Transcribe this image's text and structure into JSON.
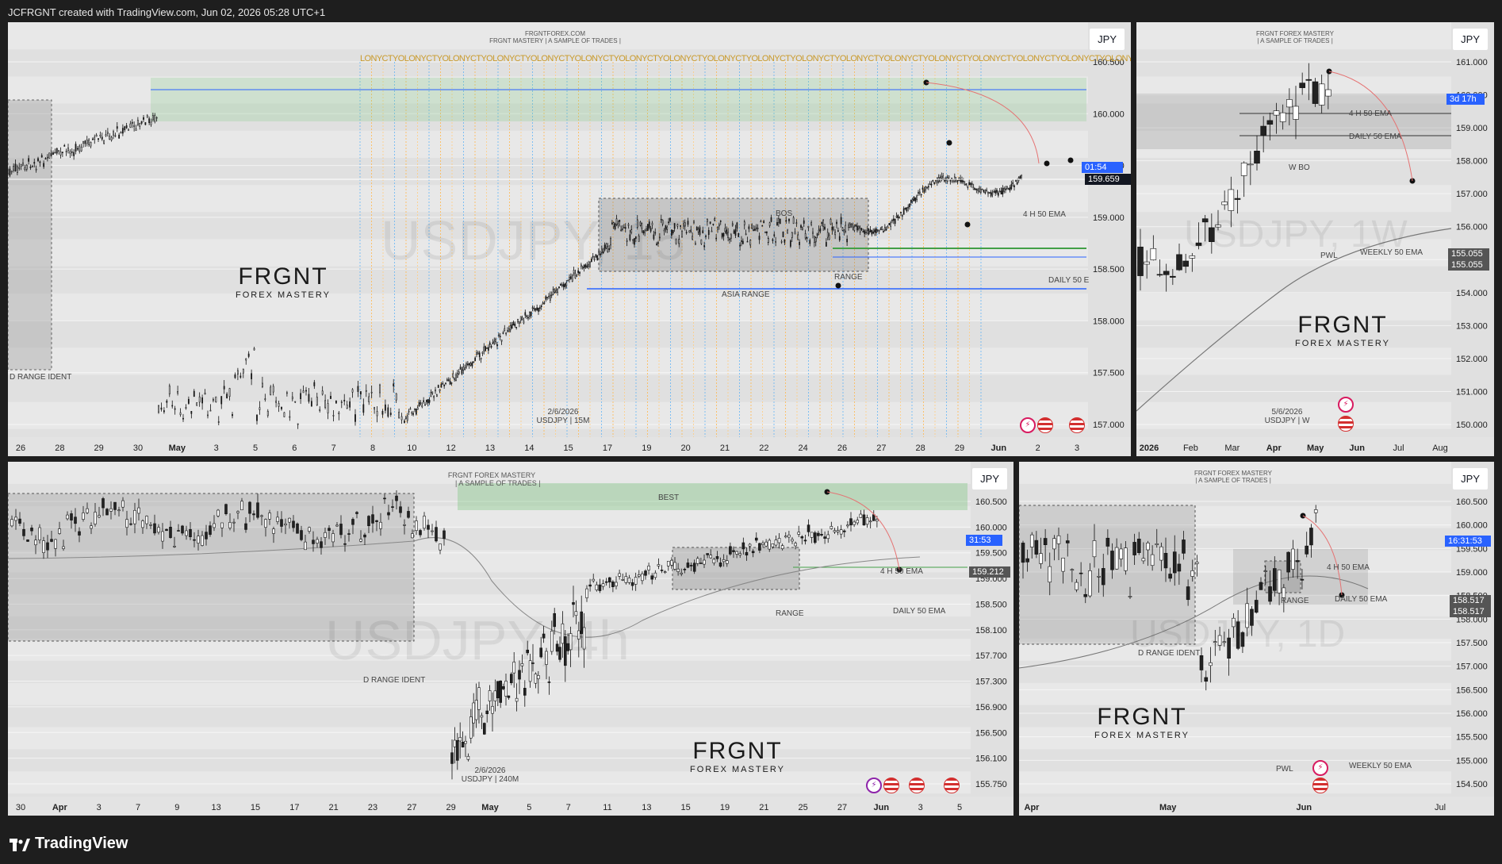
{
  "topbar": {
    "caption": "JCFRGNT created with TradingView.com, Jun 02, 2026 05:28 UTC+1"
  },
  "brand": {
    "name": "TradingView"
  },
  "colors": {
    "up": "#222",
    "down": "#222",
    "blue_line": "#2962ff",
    "green_zone": "#a5d6a7",
    "label_blue": "#2962ff"
  },
  "panels": [
    {
      "id": "p1",
      "symbol": "JPY",
      "header": [
        "FRGNTFOREX.COM",
        "FRGNT MASTERY | A SAMPLE OF TRADES |"
      ],
      "sessions_strip": "LONYCTYOLONYCTYOLONYCTYOLONYCTYOLONYCTYOLONYCTYOLONYCTYOLONYCTYOLONYCTYOLONYCTYOLONYCTYOLONYCTYOLONYCTYOLONYCTYOLONYCTYOLONYCTYOLONYCTYOLONYCTYO",
      "watermark": "USDJPY, 15",
      "corner_note": [
        "2/6/2026",
        "USDJPY | 15M"
      ],
      "labels": {
        "range_ident": "D RANGE IDENT",
        "bos": "BOS",
        "range": "RANGE",
        "asia_range": "ASIA RANGE",
        "ema4h": "4 H 50 EMA",
        "daily50": "DAILY 50 E"
      },
      "countdown": "01:54",
      "last_price": "159.659",
      "price_ticks": [
        "160.500",
        "160.000",
        "159.500",
        "159.000",
        "158.500",
        "158.000",
        "157.500",
        "157.000"
      ],
      "time_ticks": [
        "26",
        "28",
        "29",
        "30",
        "May",
        "3",
        "5",
        "6",
        "7",
        "8",
        "10",
        "12",
        "13",
        "14",
        "15",
        "17",
        "19",
        "20",
        "21",
        "22",
        "24",
        "26",
        "27",
        "28",
        "29",
        "Jun",
        "2",
        "3"
      ]
    },
    {
      "id": "p2",
      "symbol": "JPY",
      "header": [
        "FRGNT FOREX MASTERY",
        "| A SAMPLE OF TRADES |"
      ],
      "watermark": "USDJPY, 1W",
      "corner_note": [
        "5/6/2026",
        "USDJPY | W"
      ],
      "labels": {
        "ema4h": "4 H 50 EMA",
        "daily50": "DAILY 50 EMA",
        "wbo": "W BO",
        "pwl": "PWL",
        "weekly50": "WEEKLY 50 EMA"
      },
      "countdown": "3d 17h",
      "price_boxes": [
        "155.055",
        "155.055"
      ],
      "price_ticks": [
        "161.000",
        "160.000",
        "159.000",
        "158.000",
        "157.000",
        "156.000",
        "155.000",
        "154.000",
        "153.000",
        "152.000",
        "151.000",
        "150.000"
      ],
      "time_ticks": [
        "2026",
        "Feb",
        "Mar",
        "Apr",
        "May",
        "Jun",
        "Jul",
        "Aug"
      ]
    },
    {
      "id": "p3",
      "symbol": "JPY",
      "header": [
        "FRGNT FOREX MASTERY",
        "| A SAMPLE OF TRADES |"
      ],
      "watermark": "USDJPY, 4h",
      "corner_note": [
        "2/6/2026",
        "USDJPY | 240M"
      ],
      "labels": {
        "best": "BEST",
        "ema4h": "4 H 50 EMA",
        "daily50": "DAILY 50 EMA",
        "range": "RANGE",
        "range_ident": "D RANGE IDENT"
      },
      "countdown": "31:53",
      "last_price": "159.212",
      "price_ticks": [
        "160.500",
        "160.000",
        "159.500",
        "159.000",
        "158.500",
        "158.100",
        "157.700",
        "157.300",
        "156.900",
        "156.500",
        "156.100",
        "155.750"
      ],
      "time_ticks": [
        "30",
        "Apr",
        "3",
        "7",
        "9",
        "13",
        "15",
        "17",
        "21",
        "23",
        "27",
        "29",
        "May",
        "5",
        "7",
        "11",
        "13",
        "15",
        "19",
        "21",
        "25",
        "27",
        "Jun",
        "3",
        "5"
      ]
    },
    {
      "id": "p4",
      "symbol": "JPY",
      "header": [
        "FRGNT FOREX MASTERY",
        "| A SAMPLE OF TRADES |"
      ],
      "watermark": "USDJPY, 1D",
      "labels": {
        "range": "RANGE",
        "ema4h": "4 H 50 EMA",
        "daily50": "DAILY 50 EMA",
        "range_ident": "D RANGE IDENT",
        "pwl": "PWL",
        "weekly50": "WEEKLY 50 EMA"
      },
      "countdown": "16:31:53",
      "price_boxes": [
        "158.517",
        "158.517"
      ],
      "price_ticks": [
        "160.500",
        "160.000",
        "159.500",
        "159.000",
        "158.500",
        "158.000",
        "157.500",
        "157.000",
        "156.500",
        "156.000",
        "155.500",
        "155.000",
        "154.500"
      ],
      "time_ticks": [
        "Apr",
        "May",
        "Jun",
        "Jul"
      ]
    }
  ],
  "logo": {
    "name": "FRGNT",
    "tagline": "FOREX MASTERY"
  }
}
